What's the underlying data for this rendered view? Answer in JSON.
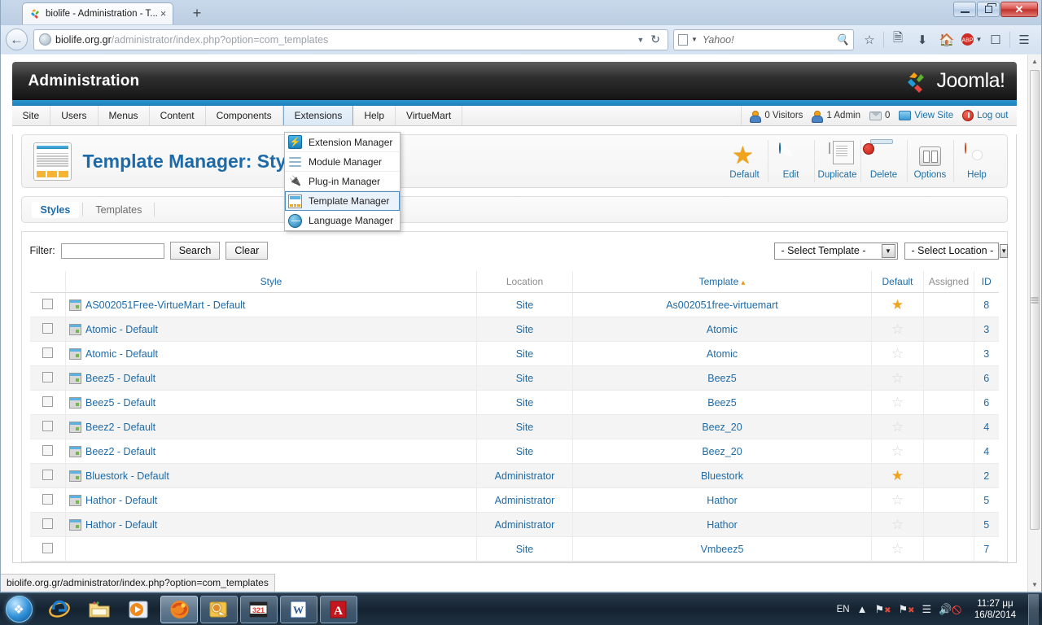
{
  "browser": {
    "tab": {
      "title": "biolife - Administration - T...",
      "close_label": "×",
      "favicon_name": "joomla-favicon"
    },
    "newtab_label": "+",
    "url_domain": "biolife.org.gr",
    "url_path": "/administrator/index.php?option=com_templates",
    "search_placeholder": "Yahoo!",
    "window_controls": {
      "minimize": "minimize",
      "restore": "restore",
      "close": "✕"
    },
    "statusbar_text": "biolife.org.gr/administrator/index.php?option=com_templates",
    "toolbar_icons": [
      "bookmark-star-icon",
      "reading-list-icon",
      "downloads-icon",
      "home-icon",
      "adblock-icon",
      "tab-groups-icon",
      "menu-icon"
    ]
  },
  "joomla": {
    "header_title": "Administration",
    "logo_text": "Joomla!",
    "menubar": [
      {
        "label": "Site",
        "active": false
      },
      {
        "label": "Users",
        "active": false
      },
      {
        "label": "Menus",
        "active": false
      },
      {
        "label": "Content",
        "active": false
      },
      {
        "label": "Components",
        "active": false
      },
      {
        "label": "Extensions",
        "active": true
      },
      {
        "label": "Help",
        "active": false
      },
      {
        "label": "VirtueMart",
        "active": false
      }
    ],
    "status": {
      "visitors": "0 Visitors",
      "admins": "1 Admin",
      "messages": "0",
      "view_site": "View Site",
      "logout": "Log out"
    },
    "dropdown": {
      "items": [
        {
          "label": "Extension Manager",
          "icon": "extension-manager-icon",
          "selected": false
        },
        {
          "label": "Module Manager",
          "icon": "module-manager-icon",
          "selected": false
        },
        {
          "label": "Plug-in Manager",
          "icon": "plugin-manager-icon",
          "selected": false
        },
        {
          "label": "Template Manager",
          "icon": "template-manager-icon",
          "selected": true
        },
        {
          "label": "Language Manager",
          "icon": "language-manager-icon",
          "selected": false
        }
      ]
    },
    "page_title": "Template Manager: Style",
    "toolbar": [
      {
        "label": "Default",
        "icon": "star-icon"
      },
      {
        "label": "Edit",
        "icon": "pencil-icon"
      },
      {
        "label": "Duplicate",
        "icon": "copy-documents-icon"
      },
      {
        "label": "Delete",
        "icon": "trash-icon"
      },
      {
        "label": "Options",
        "icon": "options-icon"
      },
      {
        "label": "Help",
        "icon": "life-ring-icon"
      }
    ],
    "subtabs": [
      {
        "label": "Styles",
        "active": true
      },
      {
        "label": "Templates",
        "active": false
      }
    ],
    "filter": {
      "label": "Filter:",
      "value": "",
      "placeholder": "",
      "search_label": "Search",
      "clear_label": "Clear",
      "select_template": "- Select Template -",
      "select_location": "- Select Location -"
    },
    "table": {
      "headers": {
        "check": "",
        "style": "Style",
        "location": "Location",
        "template": "Template",
        "default": "Default",
        "assigned": "Assigned",
        "id": "ID"
      },
      "sort_column": "Template",
      "rows": [
        {
          "style": "AS002051Free-VirtueMart - Default",
          "location": "Site",
          "template": "As002051free-virtuemart",
          "default": true,
          "assigned": "",
          "id": "8"
        },
        {
          "style": "Atomic - Default",
          "location": "Site",
          "template": "Atomic",
          "default": false,
          "assigned": "",
          "id": "3"
        },
        {
          "style": "Atomic - Default",
          "location": "Site",
          "template": "Atomic",
          "default": false,
          "assigned": "",
          "id": "3"
        },
        {
          "style": "Beez5 - Default",
          "location": "Site",
          "template": "Beez5",
          "default": false,
          "assigned": "",
          "id": "6"
        },
        {
          "style": "Beez5 - Default",
          "location": "Site",
          "template": "Beez5",
          "default": false,
          "assigned": "",
          "id": "6"
        },
        {
          "style": "Beez2 - Default",
          "location": "Site",
          "template": "Beez_20",
          "default": false,
          "assigned": "",
          "id": "4"
        },
        {
          "style": "Beez2 - Default",
          "location": "Site",
          "template": "Beez_20",
          "default": false,
          "assigned": "",
          "id": "4"
        },
        {
          "style": "Bluestork - Default",
          "location": "Administrator",
          "template": "Bluestork",
          "default": true,
          "assigned": "",
          "id": "2"
        },
        {
          "style": "Hathor - Default",
          "location": "Administrator",
          "template": "Hathor",
          "default": false,
          "assigned": "",
          "id": "5"
        },
        {
          "style": "Hathor - Default",
          "location": "Administrator",
          "template": "Hathor",
          "default": false,
          "assigned": "",
          "id": "5"
        },
        {
          "style": "",
          "location": "Site",
          "template": "Vmbeez5",
          "default": false,
          "assigned": "",
          "id": "7"
        }
      ]
    }
  },
  "taskbar": {
    "start_label": "Start",
    "apps": [
      {
        "name": "internet-explorer",
        "glyph": "℮",
        "state": "pinned"
      },
      {
        "name": "windows-explorer",
        "glyph": "📁",
        "state": "pinned"
      },
      {
        "name": "windows-media-player",
        "glyph": "▶",
        "state": "pinned"
      },
      {
        "name": "firefox",
        "glyph": "🦊",
        "state": "pressed"
      },
      {
        "name": "microsoft-outlook",
        "glyph": "✉",
        "state": "open"
      },
      {
        "name": "video-converter-321",
        "glyph": "321",
        "state": "open"
      },
      {
        "name": "microsoft-word",
        "glyph": "W",
        "state": "open"
      },
      {
        "name": "adobe-reader",
        "glyph": "A",
        "state": "open"
      }
    ],
    "tray": {
      "language": "EN",
      "icons": [
        "show-hidden-icons",
        "network-error-icon",
        "action-center-icon",
        "signal-icon",
        "volume-muted-icon"
      ],
      "time": "11:27 μμ",
      "date": "16/8/2014"
    }
  }
}
